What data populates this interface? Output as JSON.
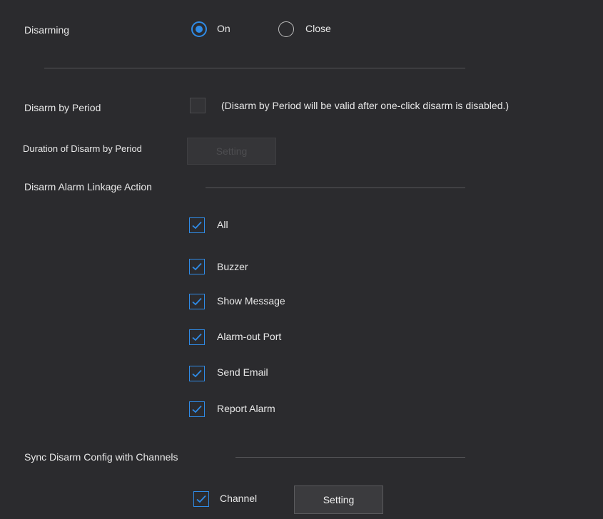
{
  "disarming": {
    "label": "Disarming",
    "options": [
      {
        "label": "On",
        "selected": true
      },
      {
        "label": "Close",
        "selected": false
      }
    ]
  },
  "disarm_by_period": {
    "label": "Disarm by Period",
    "checked": false,
    "note": "(Disarm by Period will be valid after one-click disarm is disabled.)"
  },
  "duration": {
    "label": "Duration of Disarm by Period",
    "button": "Setting",
    "enabled": false
  },
  "linkage": {
    "title": "Disarm Alarm Linkage Action",
    "items": [
      {
        "label": "All",
        "checked": true
      },
      {
        "label": "Buzzer",
        "checked": true
      },
      {
        "label": "Show Message",
        "checked": true
      },
      {
        "label": "Alarm-out Port",
        "checked": true
      },
      {
        "label": "Send Email",
        "checked": true
      },
      {
        "label": "Report Alarm",
        "checked": true
      }
    ]
  },
  "sync": {
    "title": "Sync Disarm Config with Channels",
    "channel_label": "Channel",
    "channel_checked": true,
    "button": "Setting"
  },
  "colors": {
    "background": "#2b2b2e",
    "accent": "#2f8be6",
    "text": "#e8e8e8"
  },
  "icons": {
    "radio_selected": "radio-selected-icon",
    "radio_unselected": "radio-unselected-icon",
    "checkbox_checked": "checkmark-icon"
  }
}
